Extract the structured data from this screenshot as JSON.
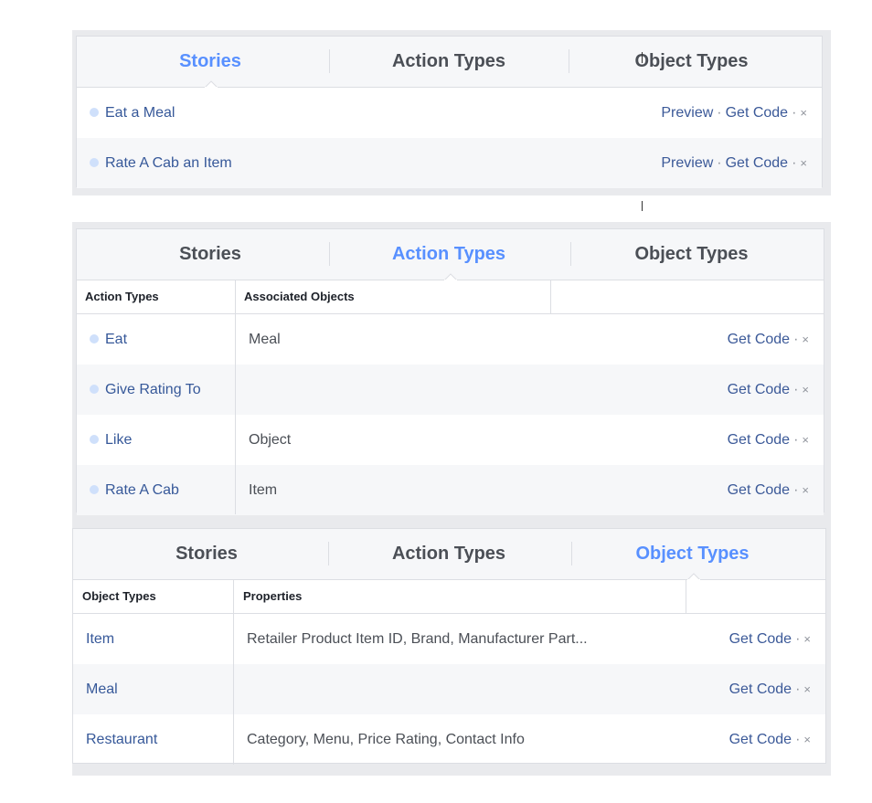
{
  "tabs": {
    "stories": "Stories",
    "action_types": "Action Types",
    "object_types": "Object Types"
  },
  "actions": {
    "preview": "Preview",
    "get_code": "Get Code",
    "separator": "·",
    "remove": "×"
  },
  "stories_panel": {
    "active_tab": "Stories",
    "rows": [
      {
        "name": "Eat a Meal"
      },
      {
        "name": "Rate A Cab an Item"
      }
    ]
  },
  "action_types_panel": {
    "active_tab": "Action Types",
    "columns": [
      "Action Types",
      "Associated Objects"
    ],
    "rows": [
      {
        "name": "Eat",
        "objects": "Meal"
      },
      {
        "name": "Give Rating To",
        "objects": ""
      },
      {
        "name": "Like",
        "objects": "Object"
      },
      {
        "name": "Rate A Cab",
        "objects": "Item"
      }
    ]
  },
  "object_types_panel": {
    "active_tab": "Object Types",
    "columns": [
      "Object Types",
      "Properties"
    ],
    "rows": [
      {
        "name": "Item",
        "properties": "Retailer Product Item ID, Brand, Manufacturer Part..."
      },
      {
        "name": "Meal",
        "properties": ""
      },
      {
        "name": "Restaurant",
        "properties": "Category, Menu, Price Rating, Contact Info"
      }
    ]
  },
  "colors": {
    "active_tab": "#5890ff",
    "link": "#3b5998",
    "bullet": "#cfe0fb",
    "panel_bg": "#e9eaed"
  }
}
